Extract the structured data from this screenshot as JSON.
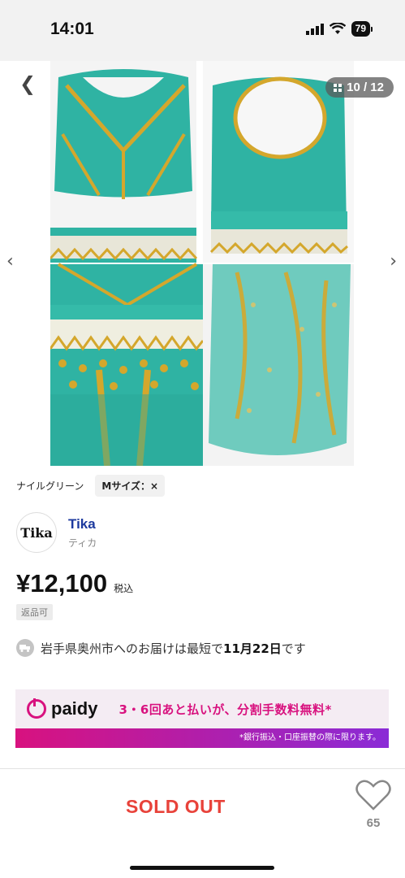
{
  "status_bar": {
    "time": "14:01",
    "battery": "79"
  },
  "gallery": {
    "counter": "10 / 12"
  },
  "variants": {
    "color": "ナイルグリーン",
    "size": "Mサイズ：×"
  },
  "shop": {
    "logo_text": "Tika",
    "name": "Tika",
    "kana": "ティカ"
  },
  "price": {
    "amount": "¥12,100",
    "tax_label": "税込",
    "return_label": "返品可"
  },
  "delivery": {
    "prefix": "岩手県奥州市へのお届けは最短で",
    "date": "11月22日",
    "suffix": "です"
  },
  "paidy": {
    "brand": "paidy",
    "promo": "3・6回あと払いが、分割手数料無料*",
    "note": "*銀行振込・口座振替の際に限ります。"
  },
  "bottom": {
    "sold_out": "SOLD OUT",
    "like_count": "65"
  },
  "colors": {
    "accent_red": "#e8423a",
    "paidy_pink": "#d8127f",
    "shop_blue": "#1d3a9e",
    "teal": "#2fb3a3",
    "gold": "#d4a72c"
  }
}
